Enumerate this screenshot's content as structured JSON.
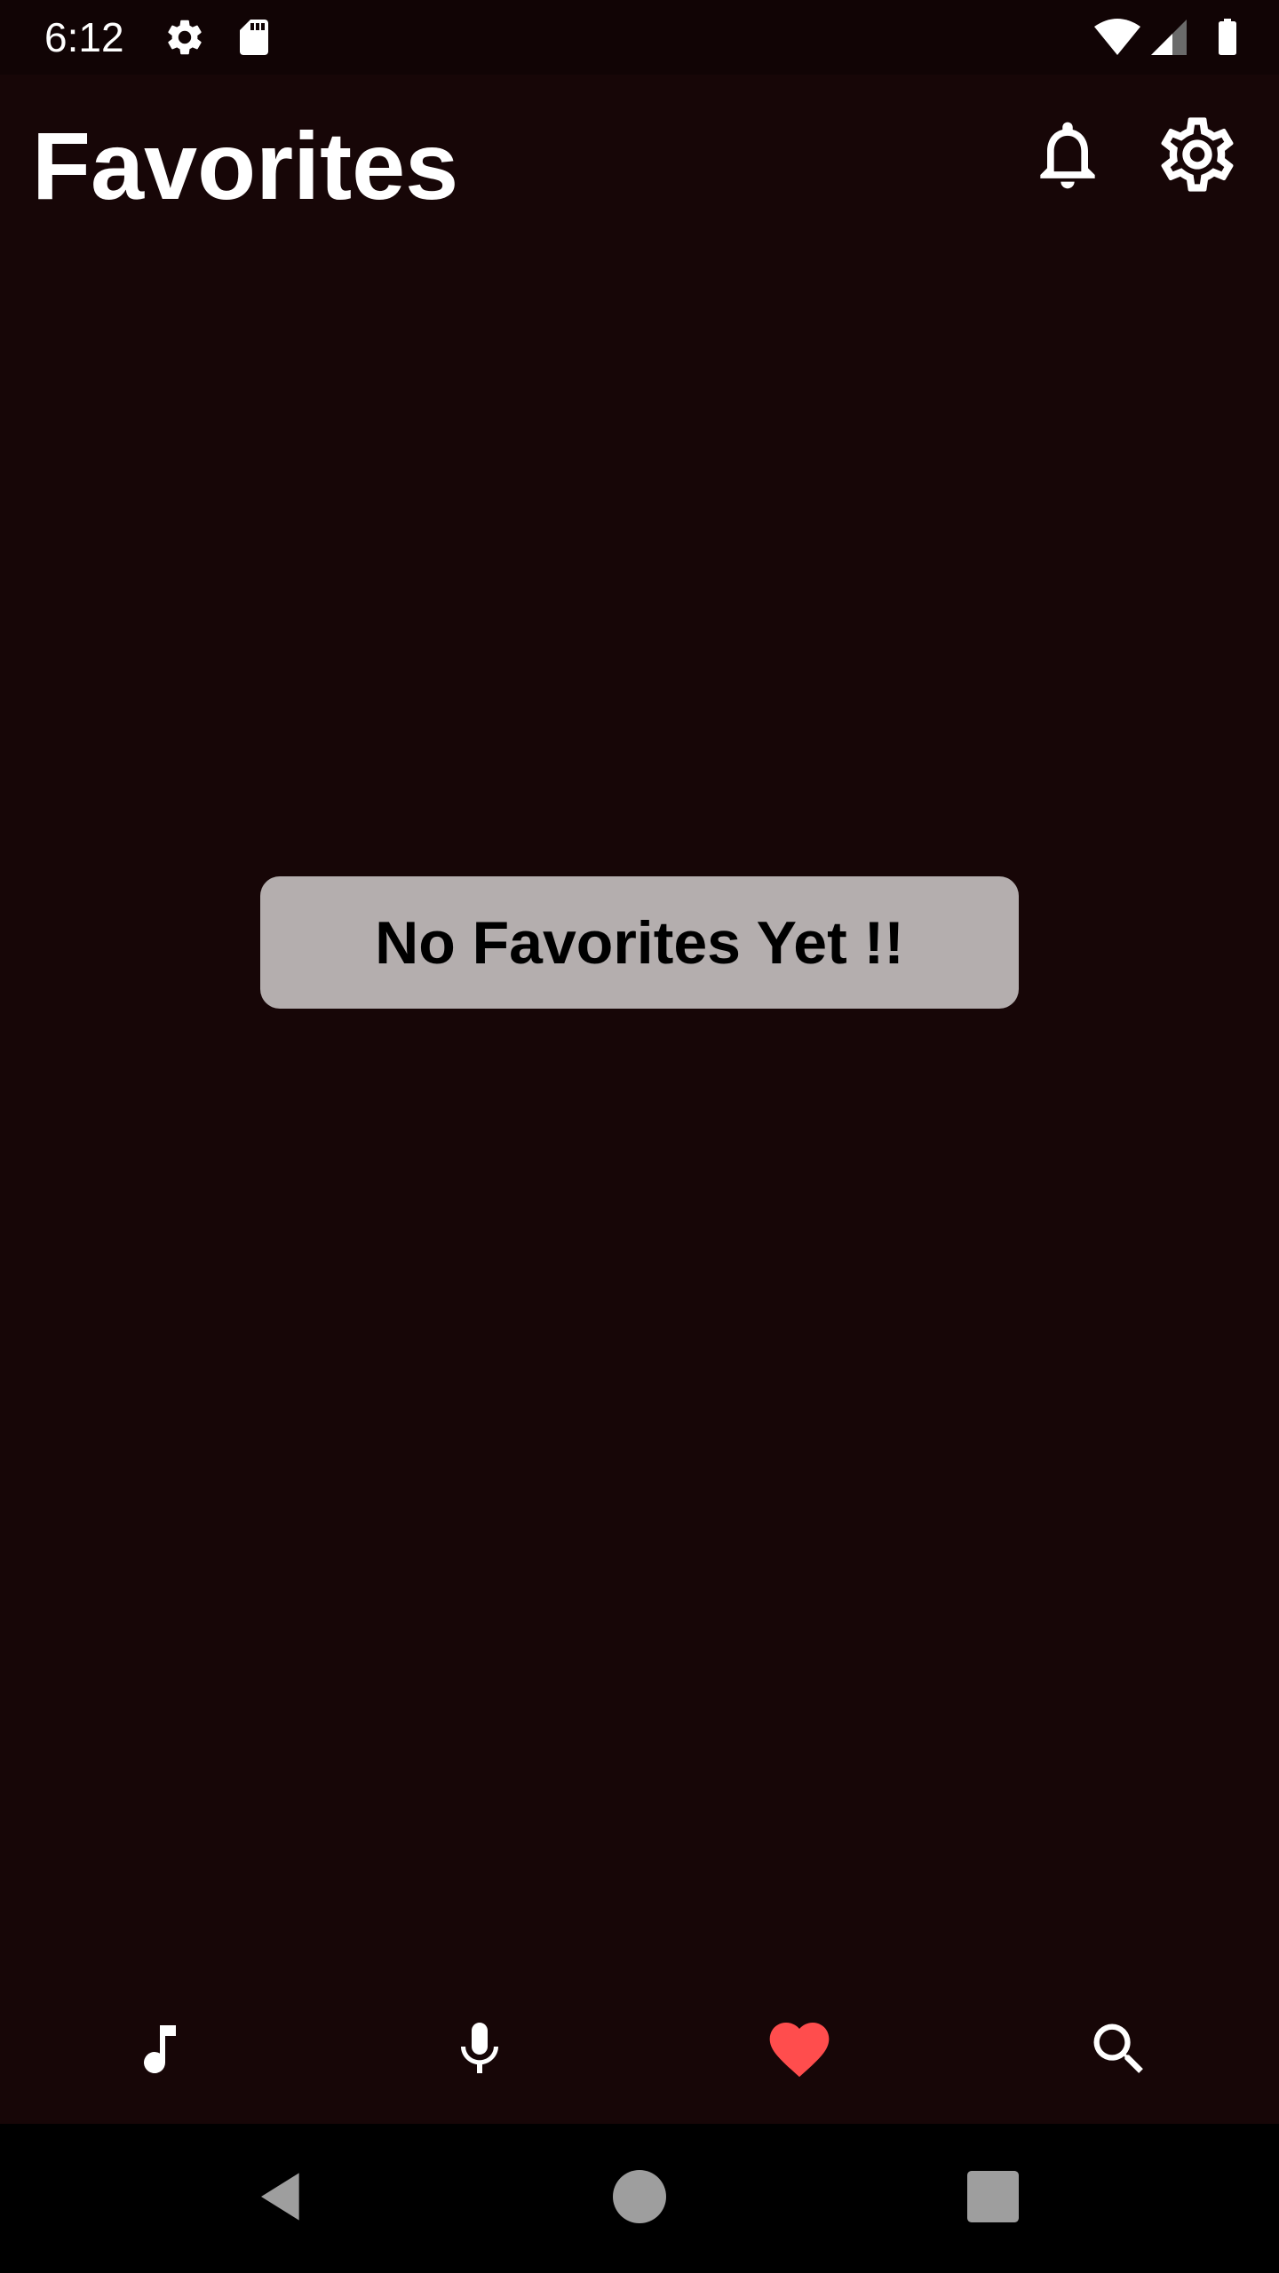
{
  "status_bar": {
    "time": "6:12",
    "icons": [
      "settings-icon",
      "sd-card-icon",
      "wifi-icon",
      "signal-icon",
      "battery-icon"
    ]
  },
  "app_bar": {
    "title": "Favorites",
    "actions": [
      "bell-icon",
      "gear-icon"
    ]
  },
  "empty_state": {
    "message": "No Favorites Yet !!"
  },
  "bottom_nav": {
    "items": [
      {
        "icon": "music-note-icon",
        "active": false
      },
      {
        "icon": "microphone-icon",
        "active": false
      },
      {
        "icon": "heart-icon",
        "active": true
      },
      {
        "icon": "search-icon",
        "active": false
      }
    ]
  },
  "system_nav": {
    "buttons": [
      "back-icon",
      "home-icon",
      "recents-icon"
    ]
  },
  "colors": {
    "background": "#170607",
    "status_bar_bg": "#110405",
    "badge_bg": "#b4aeae",
    "active_accent": "#ff4d4d",
    "icon_color": "#ffffff",
    "system_button": "#9e9e9e"
  }
}
